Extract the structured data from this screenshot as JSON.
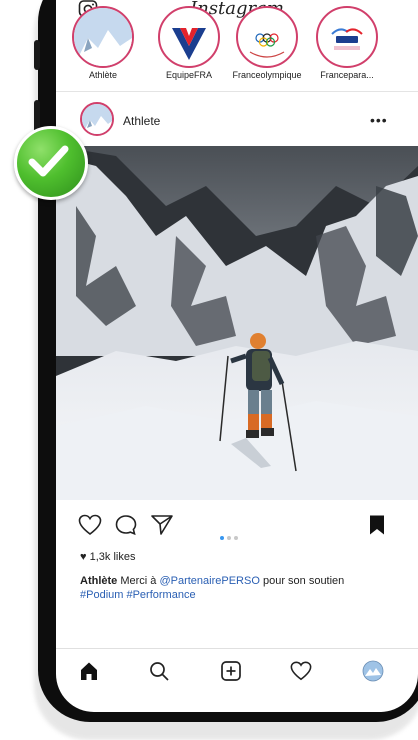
{
  "header": {
    "logo": "Instagram",
    "camera_icon": "camera-icon"
  },
  "stories": [
    {
      "label": "Athlète"
    },
    {
      "label": "EquipeFRA"
    },
    {
      "label": "Franceolympique"
    },
    {
      "label": "Francepara..."
    }
  ],
  "post": {
    "username": "Athlete",
    "more": "•••",
    "likes": "1,3k likes",
    "caption_user": "Athlète",
    "caption_text": " Merci à ",
    "caption_mention": "@PartenairePERSO",
    "caption_text2": " pour son soutien",
    "caption_tags": "#Podium #Performance",
    "carousel_count": 3,
    "carousel_index": 1
  },
  "nav": {
    "items": [
      "home-icon",
      "search-icon",
      "add-post-icon",
      "heart-icon",
      "profile-avatar"
    ]
  },
  "colors": {
    "accent": "#3897f0",
    "story_ring": "#d13f6b",
    "link": "#2a5fb3",
    "check": "#4fbf2e"
  }
}
